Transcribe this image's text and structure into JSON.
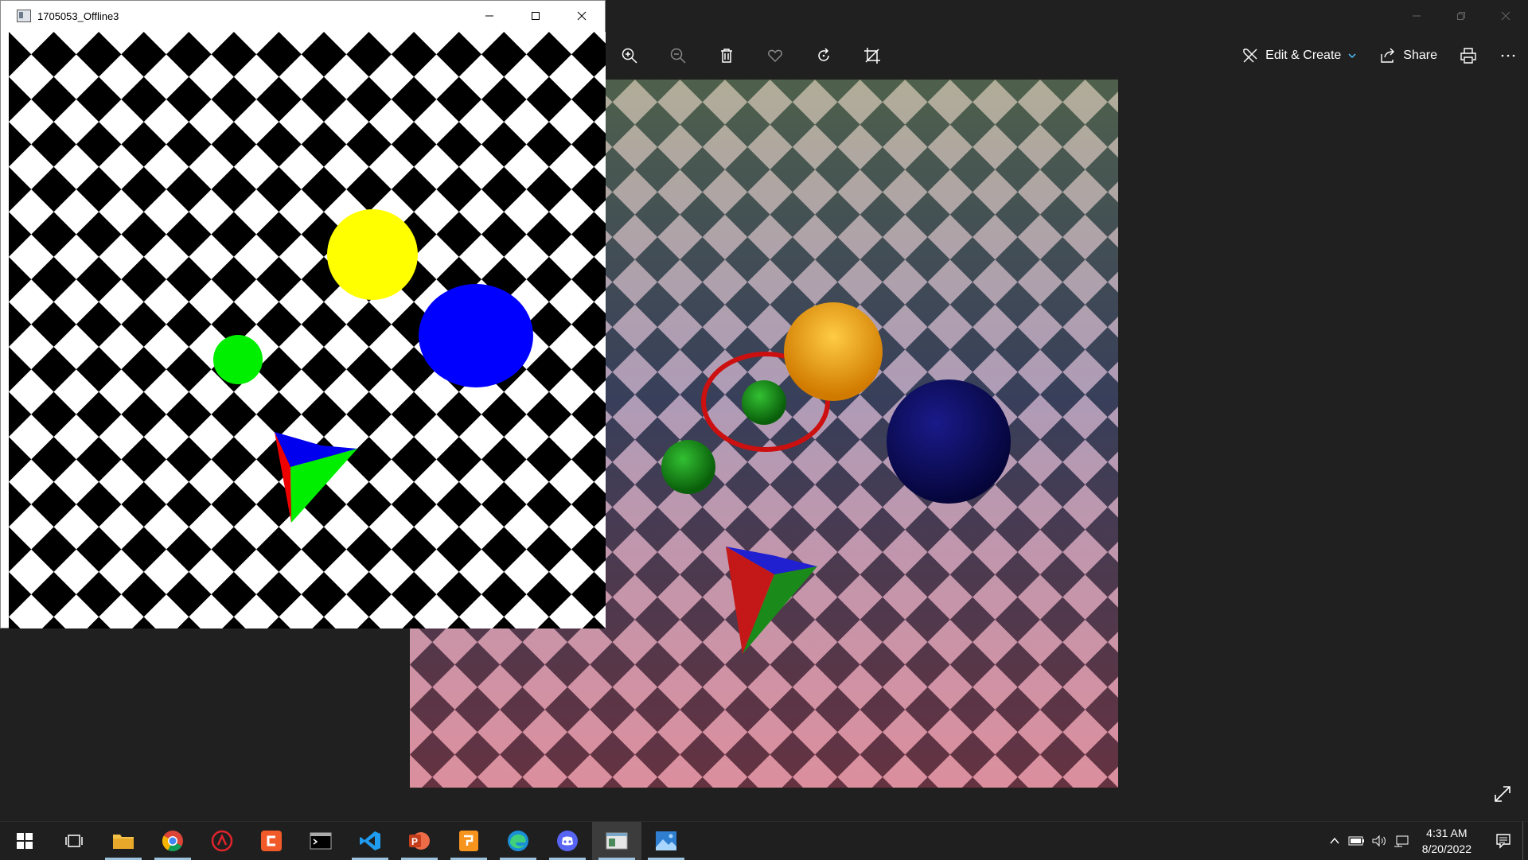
{
  "photos_app": {
    "toolbar": {
      "edit_create_label": "Edit & Create",
      "share_label": "Share"
    }
  },
  "opengl_window": {
    "title": "1705053_Offline3"
  },
  "taskbar": {
    "apps": [
      "start",
      "task-view",
      "file-explorer",
      "chrome",
      "app-red",
      "app-c",
      "terminal",
      "vscode",
      "powerpoint",
      "pdf-app",
      "edge",
      "discord",
      "opengl-app",
      "photos"
    ],
    "clock": {
      "time": "4:31 AM",
      "date": "8/20/2022"
    }
  },
  "colors": {
    "taskbar_bg": "#1f1f1f",
    "app_bg": "#202020",
    "accent": "#0ea4b0",
    "sphere_yellow": "#ffff00",
    "sphere_blue": "#0000ff",
    "sphere_green": "#00ee00"
  }
}
